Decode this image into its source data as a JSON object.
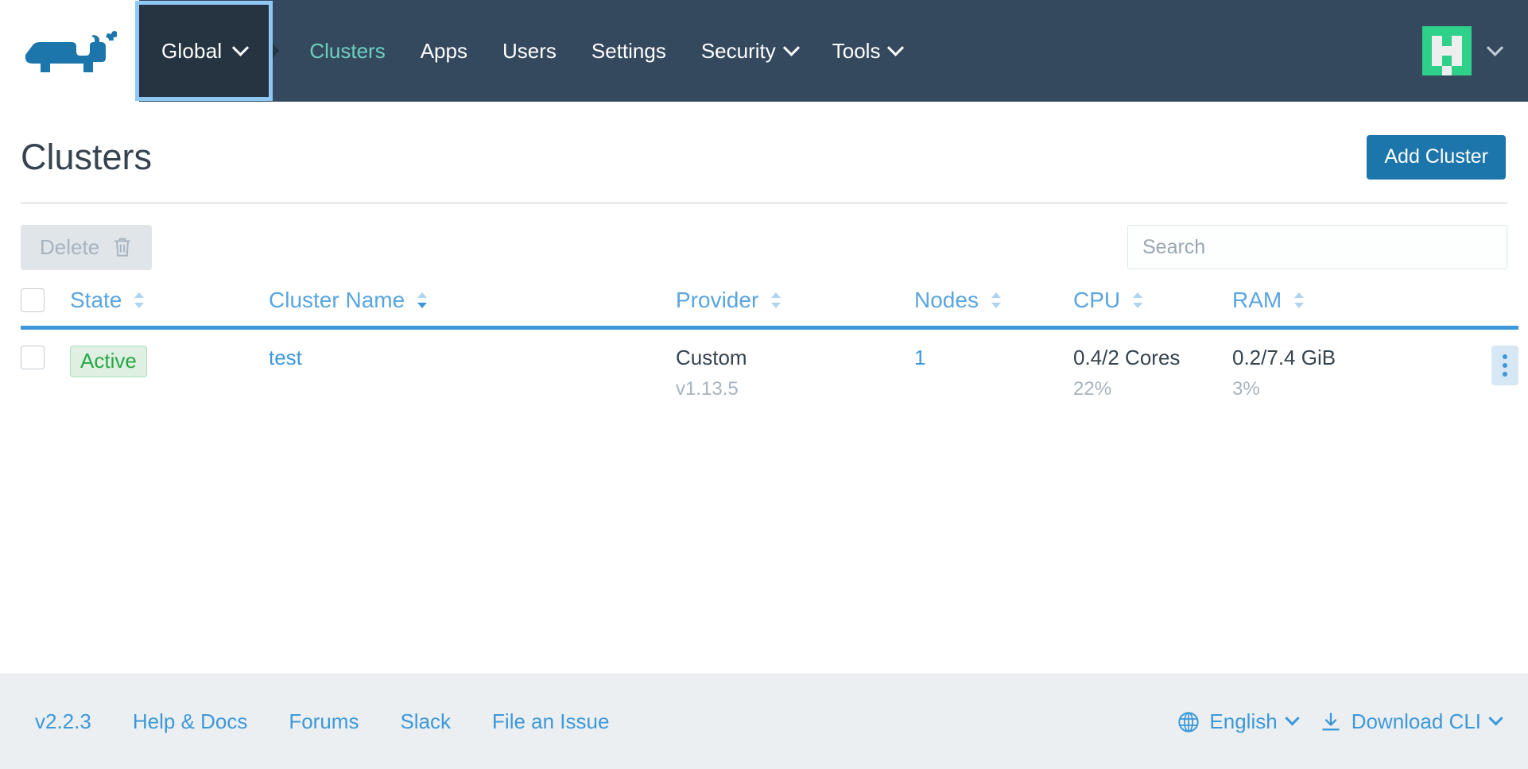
{
  "header": {
    "logo_icon": "rancher-cow-logo",
    "cluster_selector": {
      "label": "Global",
      "icon": "chevron-down-icon"
    },
    "nav_items": [
      {
        "label": "Clusters",
        "active": true,
        "has_dropdown": false,
        "icon": ""
      },
      {
        "label": "Apps",
        "active": false,
        "has_dropdown": false,
        "icon": ""
      },
      {
        "label": "Users",
        "active": false,
        "has_dropdown": false,
        "icon": ""
      },
      {
        "label": "Settings",
        "active": false,
        "has_dropdown": false,
        "icon": ""
      },
      {
        "label": "Security",
        "active": false,
        "has_dropdown": true,
        "icon": "chevron-down-icon"
      },
      {
        "label": "Tools",
        "active": false,
        "has_dropdown": true,
        "icon": "chevron-down-icon"
      }
    ],
    "user_menu": {
      "avatar_icon": "user-identicon-avatar",
      "avatar_color": "#2ed08a",
      "avatar_bg": "#eeeeee",
      "chevron_icon": "chevron-down-icon"
    },
    "bg_color": "#35495e",
    "badge_bg_color": "#263340",
    "badge_focus_ring": "#8ec9f5",
    "active_link_color": "#6cd0c0"
  },
  "page": {
    "title": "Clusters",
    "add_cluster_label": "Add Cluster",
    "primary_color": "#1c75ab"
  },
  "toolbar": {
    "delete_label": "Delete",
    "delete_icon": "trash-icon",
    "delete_disabled": true,
    "search_placeholder": "Search",
    "search_value": ""
  },
  "table": {
    "select_all_checked": false,
    "columns": [
      {
        "key": "state",
        "label": "State",
        "sortable": true,
        "sorted": "none"
      },
      {
        "key": "name",
        "label": "Cluster Name",
        "sortable": true,
        "sorted": "asc"
      },
      {
        "key": "provider",
        "label": "Provider",
        "sortable": true,
        "sorted": "none"
      },
      {
        "key": "nodes",
        "label": "Nodes",
        "sortable": true,
        "sorted": "none"
      },
      {
        "key": "cpu",
        "label": "CPU",
        "sortable": true,
        "sorted": "none"
      },
      {
        "key": "ram",
        "label": "RAM",
        "sortable": true,
        "sorted": "none"
      }
    ],
    "rows": [
      {
        "checked": false,
        "state": "Active",
        "name": "test",
        "provider": "Custom",
        "provider_version": "v1.13.5",
        "nodes": "1",
        "cpu": "0.4/2 Cores",
        "cpu_pct": "22%",
        "ram": "0.2/7.4 GiB",
        "ram_pct": "3%",
        "actions_icon": "kebab-menu-icon"
      }
    ],
    "header_color": "#5aa5e0",
    "header_rule_color": "#3d98d9",
    "state_active_color": "#28a745",
    "state_active_bg": "#dff0e3"
  },
  "footer": {
    "links": [
      {
        "label": "v2.2.3"
      },
      {
        "label": "Help & Docs"
      },
      {
        "label": "Forums"
      },
      {
        "label": "Slack"
      },
      {
        "label": "File an Issue"
      }
    ],
    "language": {
      "label": "English",
      "icon": "globe-icon",
      "chevron_icon": "chevron-down-icon"
    },
    "download_cli": {
      "label": "Download CLI",
      "icon": "download-icon",
      "chevron_icon": "chevron-down-icon"
    },
    "bg_color": "#ebeff1",
    "link_color": "#3d98d9"
  }
}
